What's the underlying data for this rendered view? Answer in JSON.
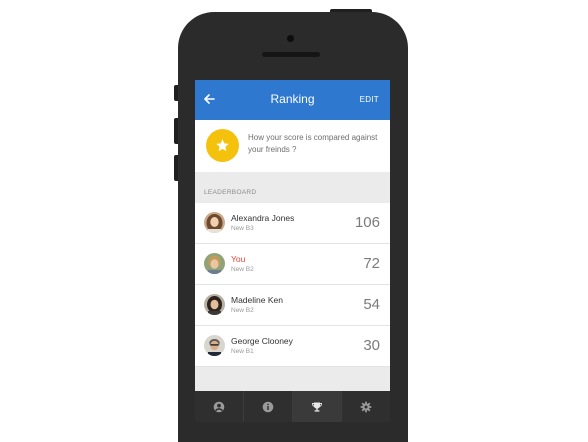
{
  "header": {
    "title": "Ranking",
    "back_icon": "arrow-left-icon",
    "edit_label": "EDIT"
  },
  "banner": {
    "icon": "star-icon",
    "text": "How your score is compared against your freinds ?"
  },
  "leaderboard": {
    "label": "LEADERBOARD",
    "entries": [
      {
        "name": "Alexandra Jones",
        "level": "New B3",
        "score": "106"
      },
      {
        "name": "You",
        "level": "New B2",
        "score": "72"
      },
      {
        "name": "Madeline Ken",
        "level": "New B2",
        "score": "54"
      },
      {
        "name": "George Clooney",
        "level": "New B1",
        "score": "30"
      }
    ]
  },
  "tabbar": {
    "tabs": [
      {
        "icon": "profile-icon"
      },
      {
        "icon": "info-icon"
      },
      {
        "icon": "trophy-icon",
        "active": true
      },
      {
        "icon": "gear-icon"
      }
    ]
  },
  "colors": {
    "accent": "#2e78cf",
    "star": "#f4c20d",
    "you": "#e5483f",
    "tabbar": "#2f2f2f"
  }
}
